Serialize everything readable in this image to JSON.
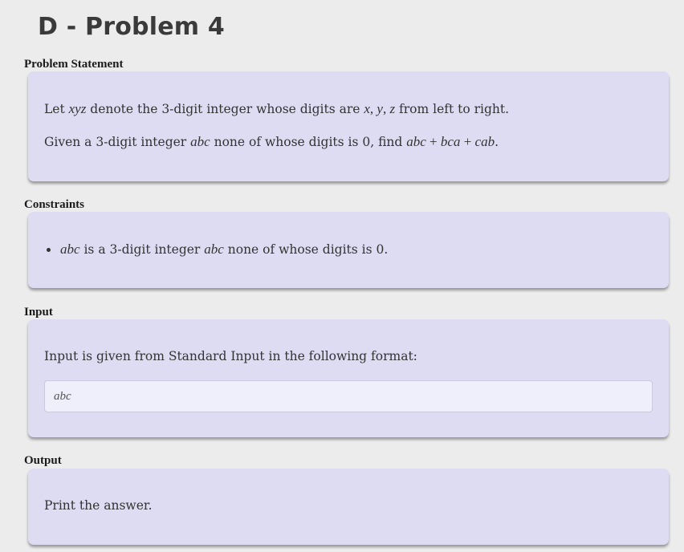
{
  "page": {
    "title": "D - Problem 4"
  },
  "sections": {
    "statement": {
      "heading": "Problem Statement",
      "line1": {
        "t1": "Let ",
        "m1": "xyz",
        "t2": " denote the 3-digit integer whose digits are ",
        "m2": "x",
        "c1": ", ",
        "m3": "y",
        "c2": ", ",
        "m4": "z",
        "t3": " from left to right."
      },
      "line2": {
        "t1": "Given a 3-digit integer ",
        "m1": "abc",
        "t2": " none of whose digits is 0, find ",
        "m2": "abc",
        "op1": " + ",
        "m3": "bca",
        "op2": " + ",
        "m4": "cab",
        "t3": "."
      }
    },
    "constraints": {
      "heading": "Constraints",
      "item1": {
        "m1": "abc",
        "t1": " is a 3-digit integer ",
        "m2": "abc",
        "t2": " none of whose digits is 0."
      }
    },
    "input": {
      "heading": "Input",
      "text": "Input is given from Standard Input in the following format:",
      "format": "abc"
    },
    "output": {
      "heading": "Output",
      "text": "Print the answer."
    }
  }
}
